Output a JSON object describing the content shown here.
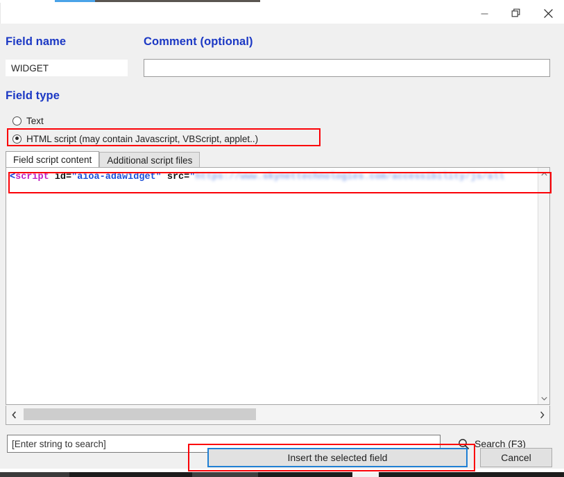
{
  "window": {
    "controls": [
      {
        "name": "minimize",
        "label": "Minimize"
      },
      {
        "name": "restore",
        "label": "Restore"
      },
      {
        "name": "close",
        "label": "Close"
      }
    ]
  },
  "form": {
    "field_name": {
      "heading": "Field name",
      "value": "WIDGET",
      "placeholder": ""
    },
    "comment": {
      "heading": "Comment (optional)",
      "value": "",
      "placeholder": ""
    },
    "field_type": {
      "heading": "Field type",
      "options": [
        {
          "label": "Text",
          "selected": false
        },
        {
          "label": "HTML script (may contain Javascript, VBScript, applet..)",
          "selected": true
        }
      ]
    }
  },
  "tabs": [
    {
      "label": "Field script content",
      "active": true
    },
    {
      "label": "Additional script files",
      "active": false
    }
  ],
  "editor": {
    "code": {
      "open_bracket": "<",
      "tag_name": "script",
      "attr_id": " id=",
      "id_value": "\"aioa-adawidget\"",
      "attr_src": " src=",
      "quote": "\"",
      "url_value": "https://www.skynettechnologies.com/accessibility/js/all"
    },
    "scrollbars": {
      "vertical_up": "▲",
      "vertical_down": "▼",
      "horizontal_left": "‹",
      "horizontal_right": "›"
    }
  },
  "search": {
    "placeholder": "[Enter string to search]",
    "value": "",
    "button_label": "Search (F3)",
    "icon": "search-icon"
  },
  "footer": {
    "insert_label": "Insert the selected field",
    "cancel_label": "Cancel"
  },
  "colors": {
    "heading_blue": "#1b38c4",
    "annotation_red": "#fb0006",
    "focus_blue": "#1f7fd4",
    "dialog_bg": "#f0f0f0",
    "code_tag": "#c11fc1",
    "code_string": "#1b4fd8"
  }
}
